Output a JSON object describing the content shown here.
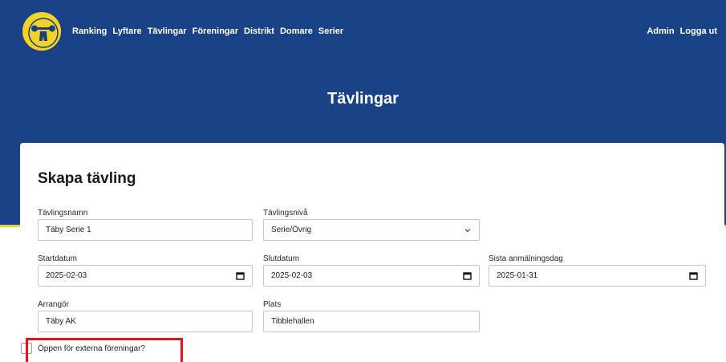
{
  "nav": {
    "left": [
      "Ranking",
      "Lyftare",
      "Tävlingar",
      "Föreningar",
      "Distrikt",
      "Domare",
      "Serier"
    ],
    "right": [
      "Admin",
      "Logga ut"
    ]
  },
  "hero": {
    "title": "Tävlingar"
  },
  "form": {
    "title": "Skapa tävling",
    "name": {
      "label": "Tävlingsnamn",
      "value": "Täby Serie 1"
    },
    "level": {
      "label": "Tävlingsnivå",
      "value": "Serie/Övrig"
    },
    "start": {
      "label": "Startdatum",
      "value": "2025-02-03"
    },
    "end": {
      "label": "Slutdatum",
      "value": "2025-02-03"
    },
    "deadline": {
      "label": "Sista anmälningsdag",
      "value": "2025-01-31"
    },
    "organizer": {
      "label": "Arrangör",
      "value": "Täby AK"
    },
    "venue": {
      "label": "Plats",
      "value": "Tibblehallen"
    },
    "external": {
      "label": "Öppen för externa föreningar?",
      "checked": false
    }
  },
  "colors": {
    "header": "#1a4387",
    "accent": "#f4d02b",
    "highlight": "#e3141b"
  },
  "icons": {
    "logo": "federation-logo-icon",
    "calendar": "calendar-icon",
    "chevron": "chevron-down-icon"
  }
}
